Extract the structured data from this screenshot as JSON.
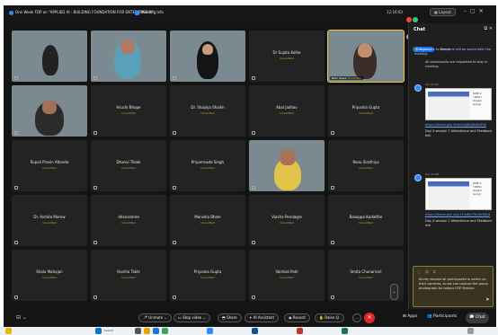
{
  "meeting": {
    "title": "One Week FDP on \"APPLIED AI : BUILDING FOUNDATION FOR ENTERPRISE AI\"",
    "info_label": "Meeting Info",
    "clock": "12:16:03",
    "layout_label": "Layout"
  },
  "tiles": [
    {
      "name": "",
      "status": "",
      "video": true
    },
    {
      "name": "",
      "status": "",
      "video": true
    },
    {
      "name": "",
      "status": "",
      "video": true
    },
    {
      "name": "Dr Sujata Kolhe",
      "status": "Unverified",
      "video": false
    },
    {
      "name": "",
      "status": "",
      "video": true,
      "tag": "Nitin Kapur",
      "tag_status": "Unverified"
    },
    {
      "name": "",
      "status": "",
      "video": true
    },
    {
      "name": "Hruchi Bhope",
      "status": "Unverified",
      "video": false
    },
    {
      "name": "Dr. Shaziya Shaikh",
      "status": "Unverified",
      "video": false
    },
    {
      "name": "Abol Jadhav",
      "status": "Unverified",
      "video": false
    },
    {
      "name": "Priyanka Gupta",
      "status": "Unverified",
      "video": false
    },
    {
      "name": "Rupali Pravin Atkarde",
      "status": "Unverified",
      "video": false
    },
    {
      "name": "Dhanvi Tikale",
      "status": "Unverified",
      "video": false
    },
    {
      "name": "Priyamvada Singh",
      "status": "Unverified",
      "video": false
    },
    {
      "name": "",
      "status": "",
      "video": true
    },
    {
      "name": "Renu Sirothiya",
      "status": "Unverified",
      "video": false
    },
    {
      "name": "Dr. Asmita Marow",
      "status": "Unverified",
      "video": false
    },
    {
      "name": "dhanashree",
      "status": "Unverified",
      "video": false
    },
    {
      "name": "Manisha Bhole",
      "status": "Unverified",
      "video": false
    },
    {
      "name": "Varsha Pendagre",
      "status": "Unverified",
      "video": false
    },
    {
      "name": "Basappa Kadatthe",
      "status": "Unverified",
      "video": false
    },
    {
      "name": "Shalu Mahajan",
      "status": "Unverified",
      "video": false
    },
    {
      "name": "Harsha Takle",
      "status": "Unverified",
      "video": false
    },
    {
      "name": "Priyanka Gupta",
      "status": "Unverified",
      "video": false
    },
    {
      "name": "Vaishali Patil",
      "status": "Unverified",
      "video": false
    },
    {
      "name": "Smita Chunarnari",
      "status": "Unverified",
      "video": false
    }
  ],
  "chat": {
    "title": "Chat",
    "tab_everyone": "Everyone",
    "tab_other": "Direct",
    "notice": "Messages to everyone will be saved after the meeting",
    "announcement": "All participants are requested to stay in meeting.",
    "messages": [
      {
        "sender": "You",
        "time": "11:27",
        "card_side": "ONE V\n\"APPLI\nOrgani\nGoogl",
        "link": "https://forms.gle/ 9hmZxbJ8Lj8tAFkFMi",
        "text": "Day 4 session 1 Attendance and Feedback link"
      },
      {
        "sender": "You",
        "time": "12:08",
        "card_side": "ONE V\n\"APPLI\nOrgani\nGoogl",
        "link": "https://forms.gle/ aQu1Fm8kUTKrXVWIL6",
        "text": "Day 4 session 2 Attendance and Feedback link"
      }
    ],
    "draft": "Kindly request all participants to switch on their cameras, so we can capture the group photograph for todays FDP Session."
  },
  "toolbar": {
    "unmute": "Unmute",
    "stop_video": "Stop video",
    "share": "Share",
    "ai_assistant": "AI Assistant",
    "record": "Record",
    "raise": "Raise",
    "apps": "Apps",
    "participants": "Participants",
    "chat": "Chat"
  },
  "taskbar": {
    "search": "Search"
  },
  "colors": {
    "accent": "#0e72ed",
    "status_unverified": "#d9a22b",
    "end_button": "#e02828"
  }
}
